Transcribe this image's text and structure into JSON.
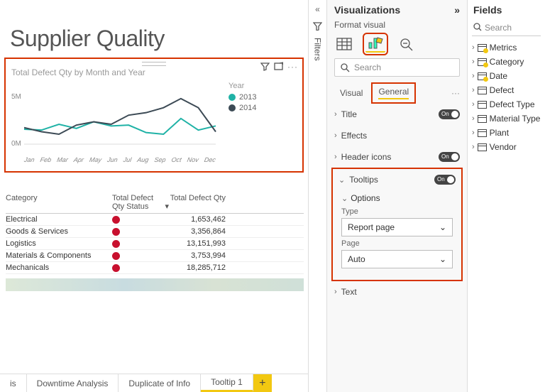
{
  "report_title": "Supplier Quality",
  "filters_label": "Filters",
  "chart_data": {
    "type": "line",
    "title": "Total Defect Qty by Month and Year",
    "categories": [
      "Jan",
      "Feb",
      "Mar",
      "Apr",
      "May",
      "Jun",
      "Jul",
      "Aug",
      "Sep",
      "Oct",
      "Nov",
      "Dec"
    ],
    "ylabel": "",
    "ylim": [
      0,
      6000000
    ],
    "yticks": [
      "0M",
      "5M"
    ],
    "legend_title": "Year",
    "series": [
      {
        "name": "2013",
        "color": "#1fb2a6",
        "values": [
          1800000,
          1700000,
          2400000,
          1900000,
          2700000,
          2200000,
          2300000,
          1400000,
          1200000,
          3100000,
          1700000,
          2200000
        ]
      },
      {
        "name": "2014",
        "color": "#3c4a55",
        "values": [
          2000000,
          1500000,
          1200000,
          2300000,
          2700000,
          2400000,
          3500000,
          3800000,
          4400000,
          5500000,
          4400000,
          1500000
        ]
      }
    ]
  },
  "table": {
    "headers": {
      "category": "Category",
      "status": "Total Defect Qty Status",
      "qty": "Total Defect Qty"
    },
    "rows": [
      {
        "category": "Electrical",
        "qty": "1,653,462"
      },
      {
        "category": "Goods & Services",
        "qty": "3,356,864"
      },
      {
        "category": "Logistics",
        "qty": "13,151,993"
      },
      {
        "category": "Materials & Components",
        "qty": "3,753,994"
      },
      {
        "category": "Mechanicals",
        "qty": "18,285,712"
      }
    ]
  },
  "tabs": [
    "is",
    "Downtime Analysis",
    "Duplicate of Info",
    "Tooltip 1"
  ],
  "viz": {
    "title": "Visualizations",
    "subtitle": "Format visual",
    "search_placeholder": "Search",
    "mode_visual": "Visual",
    "mode_general": "General",
    "cards": {
      "title": "Title",
      "effects": "Effects",
      "header": "Header icons",
      "tooltips": "Tooltips",
      "options": "Options",
      "text": "Text"
    },
    "toggles": {
      "on": "On"
    },
    "tooltips": {
      "type_label": "Type",
      "type_value": "Report page",
      "page_label": "Page",
      "page_value": "Auto"
    }
  },
  "fields": {
    "title": "Fields",
    "search_placeholder": "Search",
    "items": [
      "Metrics",
      "Category",
      "Date",
      "Defect",
      "Defect Type",
      "Material Type",
      "Plant",
      "Vendor"
    ],
    "checked": [
      true,
      true,
      true,
      false,
      false,
      false,
      false,
      false
    ]
  }
}
